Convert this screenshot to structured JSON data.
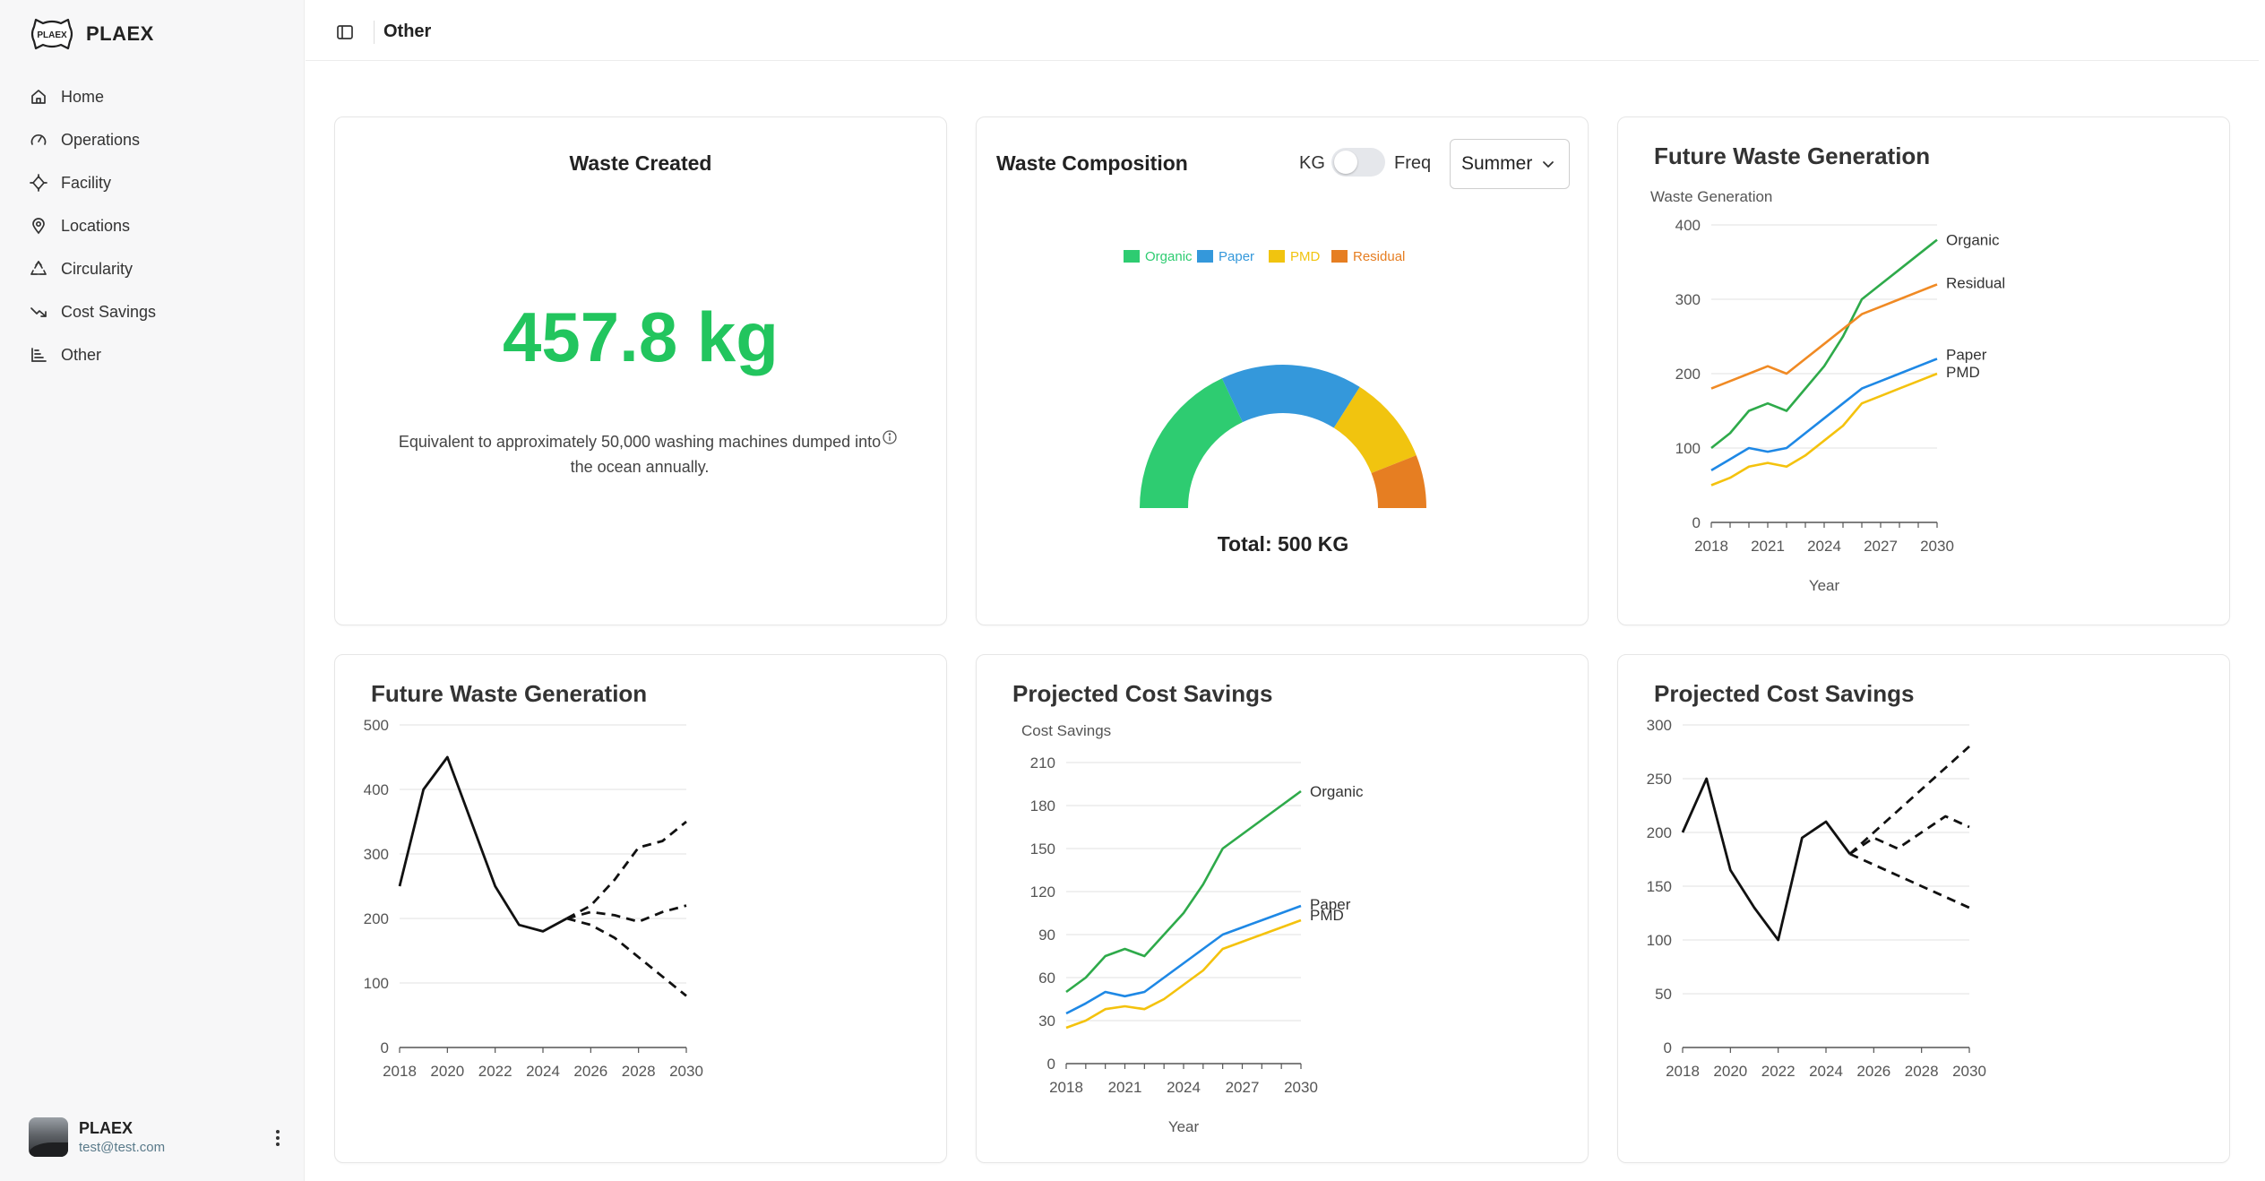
{
  "brand": {
    "name": "PLAEX",
    "logo_text": "PLAEX"
  },
  "sidebar": {
    "items": [
      {
        "label": "Home",
        "icon": "home-icon"
      },
      {
        "label": "Operations",
        "icon": "gauge-icon"
      },
      {
        "label": "Facility",
        "icon": "crosshair-icon"
      },
      {
        "label": "Locations",
        "icon": "map-pin-icon"
      },
      {
        "label": "Circularity",
        "icon": "recycle-icon"
      },
      {
        "label": "Cost Savings",
        "icon": "trending-down-icon"
      },
      {
        "label": "Other",
        "icon": "line-chart-icon"
      }
    ],
    "user": {
      "name": "PLAEX",
      "email": "test@test.com"
    }
  },
  "header": {
    "title": "Other"
  },
  "waste_created": {
    "title": "Waste Created",
    "value": "457.8 kg",
    "description": "Equivalent to approximately 50,000 washing machines dumped into the ocean annually."
  },
  "waste_composition": {
    "title": "Waste Composition",
    "toggle_left": "KG",
    "toggle_right": "Freq",
    "toggle_on": false,
    "season": "Summer",
    "total_label": "Total: 500 KG"
  },
  "colors": {
    "organic": "#2ecc71",
    "paper": "#3498db",
    "pmd": "#f1c40f",
    "residual": "#e67e22",
    "accent_green": "#22c55e"
  },
  "chart_data": [
    {
      "type": "pie",
      "variant": "half-donut",
      "categories": [
        "Organic",
        "Paper",
        "PMD",
        "Residual"
      ],
      "values": [
        180,
        160,
        100,
        60
      ],
      "total": 500,
      "legend": "top"
    },
    {
      "type": "line",
      "title": "Future Waste Generation",
      "ylabel": "Waste Generation",
      "xlabel": "Year",
      "ylim": [
        0,
        400
      ],
      "xlim": [
        2018,
        2030
      ],
      "yticks": [
        0,
        100,
        200,
        300,
        400
      ],
      "xticks": [
        2018,
        2021,
        2024,
        2027,
        2030
      ],
      "grid": true,
      "series": [
        {
          "name": "Organic",
          "color": "#2eaa4a",
          "x": [
            2018,
            2019,
            2020,
            2021,
            2022,
            2023,
            2024,
            2025,
            2026,
            2027,
            2028,
            2029,
            2030
          ],
          "values": [
            100,
            120,
            150,
            160,
            150,
            180,
            210,
            250,
            300,
            320,
            340,
            360,
            380
          ]
        },
        {
          "name": "Residual",
          "color": "#f08a24",
          "x": [
            2018,
            2019,
            2020,
            2021,
            2022,
            2023,
            2024,
            2025,
            2026,
            2027,
            2028,
            2029,
            2030
          ],
          "values": [
            180,
            190,
            200,
            210,
            200,
            220,
            240,
            260,
            280,
            290,
            300,
            310,
            320
          ]
        },
        {
          "name": "Paper",
          "color": "#1e88e5",
          "x": [
            2018,
            2019,
            2020,
            2021,
            2022,
            2023,
            2024,
            2025,
            2026,
            2027,
            2028,
            2029,
            2030
          ],
          "values": [
            70,
            85,
            100,
            95,
            100,
            120,
            140,
            160,
            180,
            190,
            200,
            210,
            220
          ]
        },
        {
          "name": "PMD",
          "color": "#f4c20d",
          "x": [
            2018,
            2019,
            2020,
            2021,
            2022,
            2023,
            2024,
            2025,
            2026,
            2027,
            2028,
            2029,
            2030
          ],
          "values": [
            50,
            60,
            75,
            80,
            75,
            90,
            110,
            130,
            160,
            170,
            180,
            190,
            200
          ]
        }
      ]
    },
    {
      "type": "line",
      "title": "Future Waste Generation",
      "ylim": [
        0,
        500
      ],
      "xlim": [
        2018,
        2030
      ],
      "yticks": [
        0,
        100,
        200,
        300,
        400,
        500
      ],
      "xticks": [
        2018,
        2020,
        2022,
        2024,
        2026,
        2028,
        2030
      ],
      "grid": true,
      "series": [
        {
          "style": "solid",
          "x": [
            2018,
            2019,
            2020,
            2021,
            2022,
            2023,
            2024,
            2025
          ],
          "values": [
            250,
            400,
            450,
            350,
            250,
            190,
            180,
            200
          ]
        },
        {
          "style": "dashed",
          "x": [
            2025,
            2026,
            2027,
            2028,
            2029,
            2030
          ],
          "values": [
            200,
            220,
            260,
            310,
            320,
            350
          ]
        },
        {
          "style": "dashed",
          "x": [
            2025,
            2026,
            2027,
            2028,
            2029,
            2030
          ],
          "values": [
            200,
            210,
            205,
            195,
            210,
            220
          ]
        },
        {
          "style": "dashed",
          "x": [
            2025,
            2026,
            2027,
            2028,
            2029,
            2030
          ],
          "values": [
            200,
            190,
            170,
            140,
            110,
            80
          ]
        }
      ]
    },
    {
      "type": "line",
      "title": "Projected Cost Savings",
      "ylabel": "Cost Savings",
      "xlabel": "Year",
      "ylim": [
        0,
        210
      ],
      "xlim": [
        2018,
        2030
      ],
      "yticks": [
        0,
        30,
        60,
        90,
        120,
        150,
        180,
        210
      ],
      "xticks": [
        2018,
        2021,
        2024,
        2027,
        2030
      ],
      "grid": true,
      "series": [
        {
          "name": "Organic",
          "color": "#2eaa4a",
          "x": [
            2018,
            2019,
            2020,
            2021,
            2022,
            2023,
            2024,
            2025,
            2026,
            2027,
            2028,
            2029,
            2030
          ],
          "values": [
            50,
            60,
            75,
            80,
            75,
            90,
            105,
            125,
            150,
            160,
            170,
            180,
            190
          ]
        },
        {
          "name": "Paper",
          "color": "#1e88e5",
          "x": [
            2018,
            2019,
            2020,
            2021,
            2022,
            2023,
            2024,
            2025,
            2026,
            2027,
            2028,
            2029,
            2030
          ],
          "values": [
            35,
            42,
            50,
            47,
            50,
            60,
            70,
            80,
            90,
            95,
            100,
            105,
            110
          ]
        },
        {
          "name": "PMD",
          "color": "#f4c20d",
          "x": [
            2018,
            2019,
            2020,
            2021,
            2022,
            2023,
            2024,
            2025,
            2026,
            2027,
            2028,
            2029,
            2030
          ],
          "values": [
            25,
            30,
            38,
            40,
            38,
            45,
            55,
            65,
            80,
            85,
            90,
            95,
            100
          ]
        }
      ]
    },
    {
      "type": "line",
      "title": "Projected Cost Savings",
      "ylim": [
        0,
        300
      ],
      "xlim": [
        2018,
        2030
      ],
      "yticks": [
        0,
        50,
        100,
        150,
        200,
        250,
        300
      ],
      "xticks": [
        2018,
        2020,
        2022,
        2024,
        2026,
        2028,
        2030
      ],
      "grid": true,
      "series": [
        {
          "style": "solid",
          "x": [
            2018,
            2019,
            2020,
            2021,
            2022,
            2023,
            2024,
            2025
          ],
          "values": [
            200,
            250,
            165,
            130,
            100,
            195,
            210,
            180
          ]
        },
        {
          "style": "dashed",
          "x": [
            2025,
            2026,
            2027,
            2028,
            2029,
            2030
          ],
          "values": [
            180,
            200,
            220,
            240,
            260,
            280
          ]
        },
        {
          "style": "dashed",
          "x": [
            2025,
            2026,
            2027,
            2028,
            2029,
            2030
          ],
          "values": [
            180,
            195,
            185,
            200,
            215,
            205
          ]
        },
        {
          "style": "dashed",
          "x": [
            2025,
            2026,
            2027,
            2028,
            2029,
            2030
          ],
          "values": [
            180,
            170,
            160,
            150,
            140,
            130
          ]
        }
      ]
    }
  ]
}
